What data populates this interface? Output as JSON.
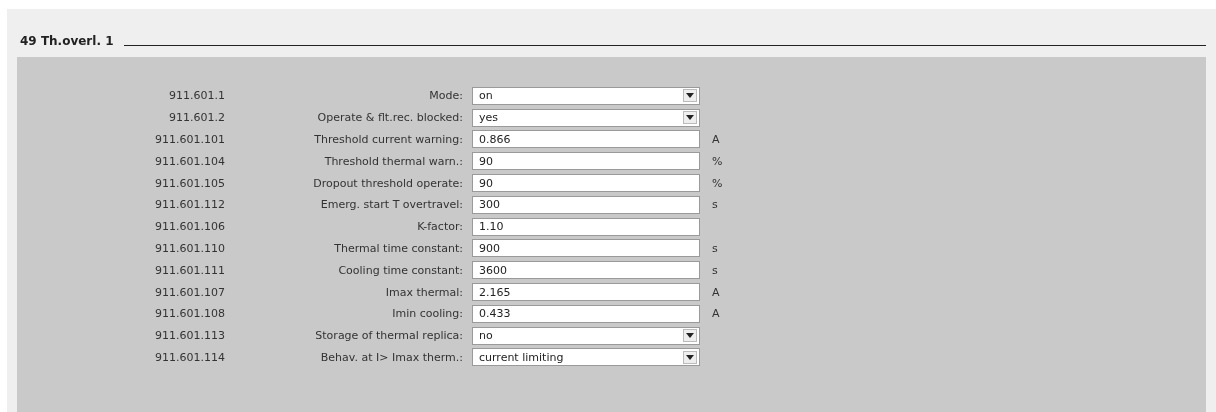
{
  "section": {
    "title": "49 Th.overl. 1"
  },
  "rows": [
    {
      "number": "911.601.1",
      "label": "Mode:",
      "kind": "dropdown",
      "value": "on"
    },
    {
      "number": "911.601.2",
      "label": "Operate & flt.rec. blocked:",
      "kind": "dropdown",
      "value": "yes"
    },
    {
      "number": "911.601.101",
      "label": "Threshold current warning:",
      "kind": "text",
      "value": "0.866",
      "unit": "A"
    },
    {
      "number": "911.601.104",
      "label": "Threshold thermal warn.:",
      "kind": "text",
      "value": "90",
      "unit": "%"
    },
    {
      "number": "911.601.105",
      "label": "Dropout threshold operate:",
      "kind": "text",
      "value": "90",
      "unit": "%"
    },
    {
      "number": "911.601.112",
      "label": "Emerg. start T overtravel:",
      "kind": "text",
      "value": "300",
      "unit": "s"
    },
    {
      "number": "911.601.106",
      "label": "K-factor:",
      "kind": "text",
      "value": "1.10"
    },
    {
      "number": "911.601.110",
      "label": "Thermal time constant:",
      "kind": "text",
      "value": "900",
      "unit": "s"
    },
    {
      "number": "911.601.111",
      "label": "Cooling time constant:",
      "kind": "text",
      "value": "3600",
      "unit": "s"
    },
    {
      "number": "911.601.107",
      "label": "Imax thermal:",
      "kind": "text",
      "value": "2.165",
      "unit": "A"
    },
    {
      "number": "911.601.108",
      "label": "Imin cooling:",
      "kind": "text",
      "value": "0.433",
      "unit": "A"
    },
    {
      "number": "911.601.113",
      "label": "Storage of thermal replica:",
      "kind": "dropdown",
      "value": "no"
    },
    {
      "number": "911.601.114",
      "label": "Behav. at I> Imax therm.:",
      "kind": "dropdown",
      "value": "current limiting"
    }
  ]
}
